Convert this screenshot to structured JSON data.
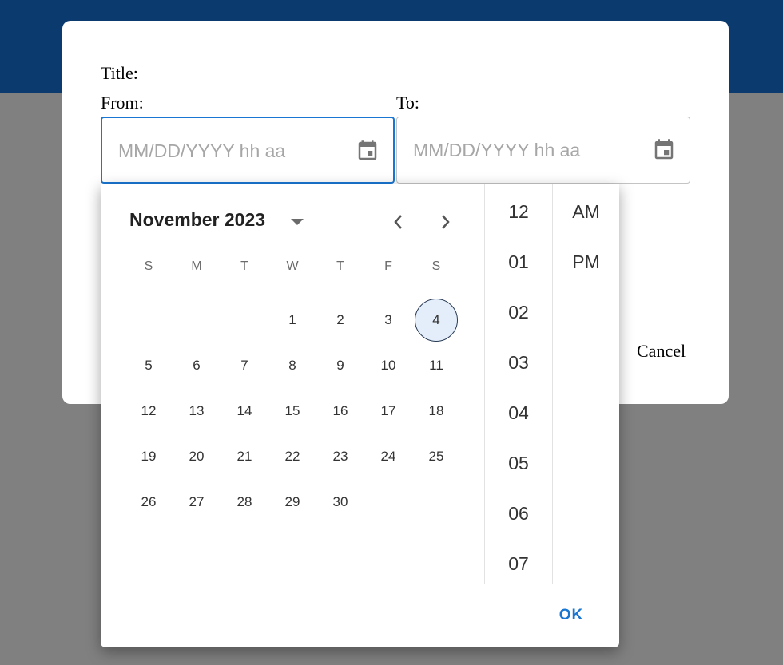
{
  "colors": {
    "header_bg": "#0b3a6e",
    "overlay": "#808080",
    "accent": "#1976d2",
    "selected_day_bg": "#e3eefa"
  },
  "form": {
    "title_label": "Title:",
    "from_label": "From:",
    "to_label": "To:",
    "cancel_label": "Cancel"
  },
  "from_field": {
    "value": "",
    "placeholder": "MM/DD/YYYY hh aa",
    "icon": "calendar-icon"
  },
  "to_field": {
    "value": "",
    "placeholder": "MM/DD/YYYY hh aa",
    "icon": "calendar-icon"
  },
  "picker": {
    "month_label": "November 2023",
    "weekdays": [
      "S",
      "M",
      "T",
      "W",
      "T",
      "F",
      "S"
    ],
    "days": [
      "",
      "",
      "",
      "1",
      "2",
      "3",
      "4",
      "5",
      "6",
      "7",
      "8",
      "9",
      "10",
      "11",
      "12",
      "13",
      "14",
      "15",
      "16",
      "17",
      "18",
      "19",
      "20",
      "21",
      "22",
      "23",
      "24",
      "25",
      "26",
      "27",
      "28",
      "29",
      "30"
    ],
    "selected_day": "4",
    "hours": [
      "12",
      "01",
      "02",
      "03",
      "04",
      "05",
      "06",
      "07"
    ],
    "meridiem": [
      "AM",
      "PM"
    ],
    "ok_label": "OK"
  }
}
